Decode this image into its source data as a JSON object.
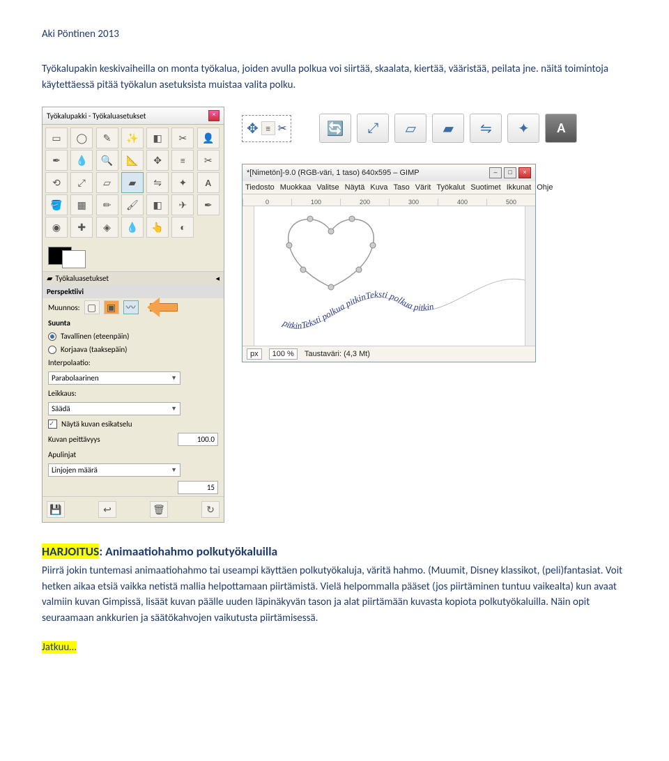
{
  "header": "Aki Pöntinen 2013",
  "intro": "Työkalupakin keskivaiheilla on monta työkalua, joiden avulla polkua voi siirtää, skaalata, kiertää, vääristää, peilata jne. näitä toimintoja käytettäessä pitää työkalun asetuksista muistaa valita polku.",
  "toolbox": {
    "title": "Työkalupakki - Työkaluasetukset",
    "sectionTools": "Työkaluasetukset",
    "perspective": "Perspektiivi",
    "transform": "Muunnos:",
    "direction": "Suunta",
    "dirNormal": "Tavallinen (eteenpäin)",
    "dirCorr": "Korjaava (taaksepäin)",
    "interp": "Interpolaatio:",
    "interpVal": "Parabolaarinen",
    "clip": "Leikkaus:",
    "clipVal": "Säädä",
    "preview": "Näytä kuvan esikatselu",
    "opacity": "Kuvan peittävyys",
    "opacityVal": "100.0",
    "guides": "Apulinjat",
    "guideCount": "Linjojen määrä",
    "guideCountVal": "15"
  },
  "gimp": {
    "title": "*[Nimetön]-9.0 (RGB-väri, 1 taso) 640x595 – GIMP",
    "menu": [
      "Tiedosto",
      "Muokkaa",
      "Valitse",
      "Näytä",
      "Kuva",
      "Taso",
      "Värit",
      "Työkalut",
      "Suotimet",
      "Ikkunat",
      "Ohje"
    ],
    "rulerTop": [
      "0",
      "100",
      "200",
      "300",
      "400",
      "500"
    ],
    "statusUnit": "px",
    "statusZoom": "100 %",
    "statusBg": "Taustaväri: (4,3 Mt)",
    "canvasText": "pitkinTeksti  polkua  pitkinTeksti  polkua  pitkin"
  },
  "exercise": {
    "titleLabel": "HARJOITUS",
    "titleRest": ": Animaatiohahmo polkutyökaluilla",
    "body1": "Piirrä jokin tuntemasi animaatiohahmo tai useampi käyttäen polkutyökaluja, väritä hahmo. (Muumit, Disney klassikot, (peli)fantasiat. Voit hetken aikaa etsiä vaikka netistä mallia helpottamaan piirtämistä. Vielä helpommalla pääset (jos piirtäminen tuntuu vaikealta) kun avaat valmiin kuvan Gimpissä, lisäät kuvan päälle uuden läpinäkyvän tason ja alat piirtämään kuvasta kopiota polkutyökaluilla. Näin opit seuraamaan ankkurien ja säätökahvojen vaikutusta piirtämisessä.",
    "cont": "Jatkuu…"
  }
}
